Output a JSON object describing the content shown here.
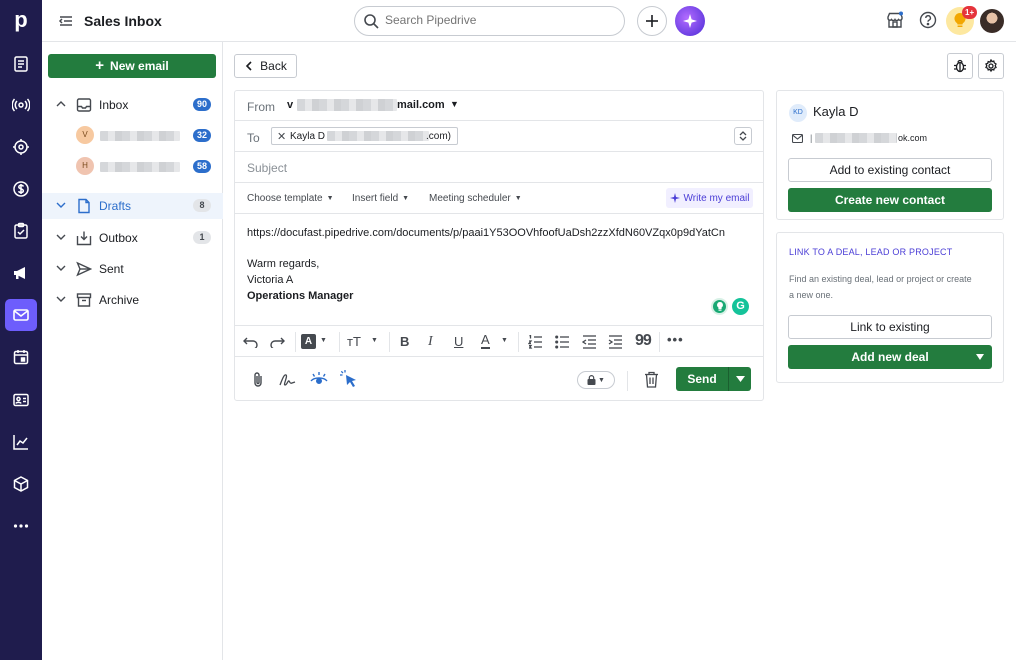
{
  "app": {
    "title": "Sales Inbox",
    "logo": "p"
  },
  "nav_icons": [
    "leads-icon",
    "radar-icon",
    "target-icon",
    "dollar-icon",
    "tasks-icon",
    "megaphone-icon",
    "mail-icon",
    "calendar-icon",
    "contacts-icon",
    "chart-icon",
    "box-icon",
    "more-icon"
  ],
  "topbar": {
    "search_placeholder": "Search Pipedrive",
    "notification_count": "1+"
  },
  "sidebar": {
    "new_email_label": "New email",
    "inbox": {
      "label": "Inbox",
      "count": "90"
    },
    "accounts": [
      {
        "initial": "V",
        "count": "32",
        "color": "#f7c9a0"
      },
      {
        "initial": "H",
        "count": "58",
        "color": "#f0c4b0"
      }
    ],
    "drafts": {
      "label": "Drafts",
      "count": "8"
    },
    "outbox": {
      "label": "Outbox",
      "count": "1"
    },
    "sent": {
      "label": "Sent"
    },
    "archive": {
      "label": "Archive"
    }
  },
  "compose": {
    "back_label": "Back",
    "from_label": "From",
    "from_prefix": "v",
    "from_suffix": "mail.com",
    "to_label": "To",
    "to_chip_name": "Kayla D",
    "to_chip_tail": ".com)",
    "subject_placeholder": "Subject",
    "tools": {
      "template": "Choose template",
      "field": "Insert field",
      "scheduler": "Meeting scheduler",
      "ai": "Write my email"
    },
    "body": {
      "link": "https://docufast.pipedrive.com/documents/p/paai1Y53OOVhfoofUaDsh2zzXfdN60VZqx0p9dYatCn",
      "closing": "Warm regards,",
      "name": "Victoria A",
      "role": "Operations Manager"
    },
    "send_label": "Send"
  },
  "contact": {
    "initials": "KD",
    "name": "Kayla D",
    "email_suffix": "ok.com",
    "add_existing": "Add to existing contact",
    "create_new": "Create new contact"
  },
  "link_panel": {
    "heading": "LINK TO A DEAL, LEAD OR PROJECT",
    "desc_line1": "Find an existing deal, lead or project or create",
    "desc_line2": "a new one.",
    "link_existing": "Link to existing",
    "add_deal": "Add new deal"
  },
  "colors": {
    "rail": "#1f1c4d",
    "accent": "#6d5dfc",
    "primary_green": "#237c3e",
    "link_blue": "#2c6ecb"
  }
}
